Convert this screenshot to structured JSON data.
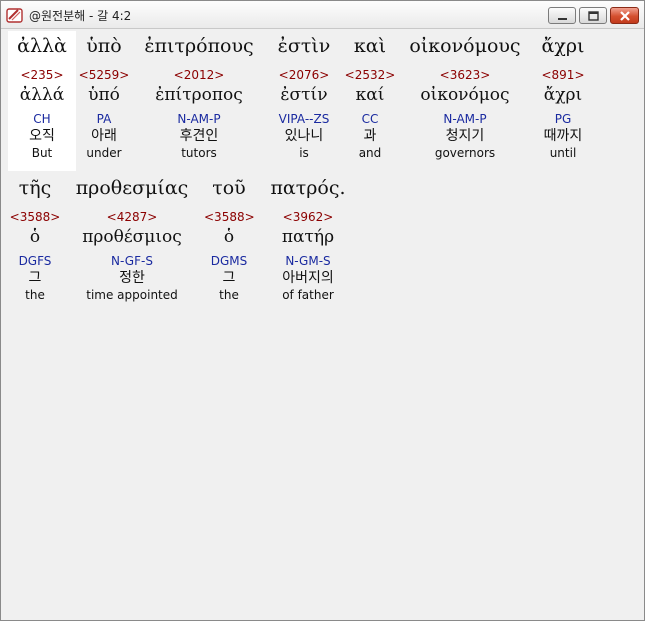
{
  "window": {
    "title": "@원전분해 - 갈 4:2"
  },
  "words": [
    {
      "greek": "ἀλλὰ",
      "strongs": "<235>",
      "lemma": "ἀλλά",
      "morph": "CH",
      "korean": "오직",
      "english": "But"
    },
    {
      "greek": "ὑπὸ",
      "strongs": "<5259>",
      "lemma": "ὑπό",
      "morph": "PA",
      "korean": "아래",
      "english": "under"
    },
    {
      "greek": "ἐπιτρόπους",
      "strongs": "<2012>",
      "lemma": "ἐπίτροπος",
      "morph": "N-AM-P",
      "korean": "후견인",
      "english": "tutors"
    },
    {
      "greek": "ἐστὶν",
      "strongs": "<2076>",
      "lemma": "ἐστίν",
      "morph": "VIPA--ZS",
      "korean": "있나니",
      "english": "is"
    },
    {
      "greek": "καὶ",
      "strongs": "<2532>",
      "lemma": "καί",
      "morph": "CC",
      "korean": "과",
      "english": "and"
    },
    {
      "greek": "οἰκονόμους",
      "strongs": "<3623>",
      "lemma": "οἰκονόμος",
      "morph": "N-AM-P",
      "korean": "청지기",
      "english": "governors"
    },
    {
      "greek": "ἄχρι",
      "strongs": "<891>",
      "lemma": "ἄχρι",
      "morph": "PG",
      "korean": "때까지",
      "english": "until"
    },
    {
      "greek": "τῆς",
      "strongs": "<3588>",
      "lemma": "ὁ",
      "morph": "DGFS",
      "korean": "그",
      "english": "the"
    },
    {
      "greek": "προθεσμίας",
      "strongs": "<4287>",
      "lemma": "προθέσμιος",
      "morph": "N-GF-S",
      "korean": "정한",
      "english": "time appointed"
    },
    {
      "greek": "τοῦ",
      "strongs": "<3588>",
      "lemma": "ὁ",
      "morph": "DGMS",
      "korean": "그",
      "english": "the"
    },
    {
      "greek": "πατρός.",
      "strongs": "<3962>",
      "lemma": "πατήρ",
      "morph": "N-GM-S",
      "korean": "아버지의",
      "english": "of father"
    }
  ]
}
